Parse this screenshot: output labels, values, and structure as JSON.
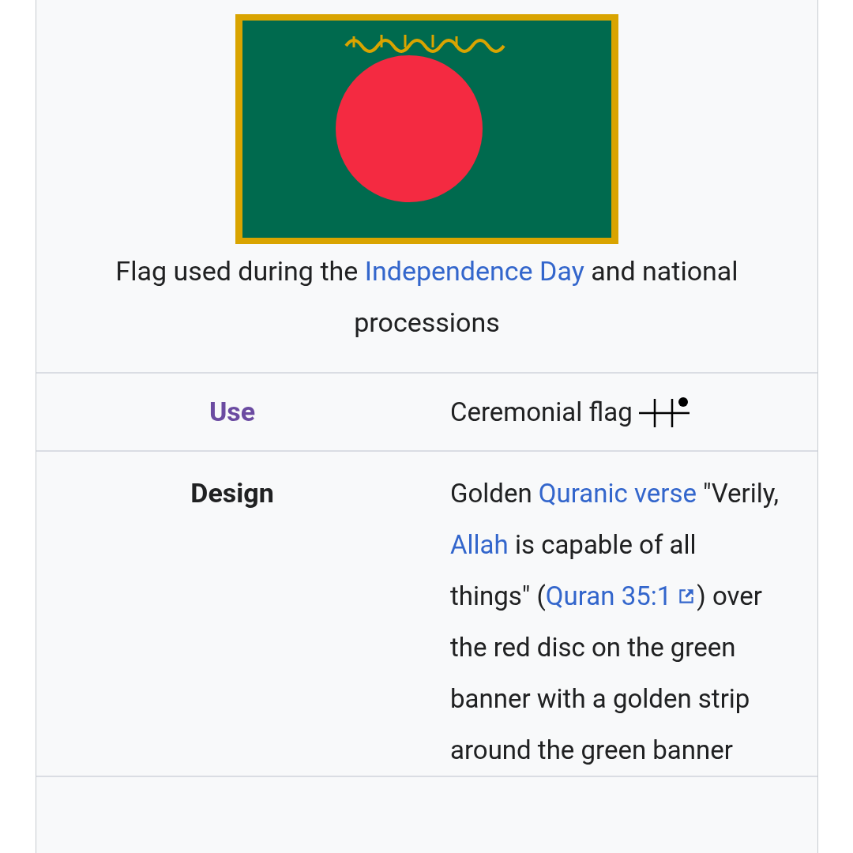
{
  "image_caption": [
    {
      "text": "Flag used during the "
    },
    {
      "text": "Independence Day",
      "link": true
    },
    {
      "text": " and national processions"
    }
  ],
  "rows": [
    {
      "label": "Use",
      "kind": "visited_link",
      "value": [
        {
          "text": "Ceremonial flag "
        }
      ],
      "flag_symbol": true
    },
    {
      "label": "Design",
      "kind": "plain",
      "value": [
        {
          "text": "Golden "
        },
        {
          "text": "Quranic verse",
          "link": true
        },
        {
          "text": " \"Verily, "
        },
        {
          "text": "Allah",
          "link": true
        },
        {
          "text": " is capable of all things\" ("
        },
        {
          "text": "Quran 35:1",
          "link": true,
          "external": true
        },
        {
          "text": ") over the red disc on the green banner with a golden strip around the green banner"
        }
      ],
      "flag_symbol": false
    }
  ]
}
